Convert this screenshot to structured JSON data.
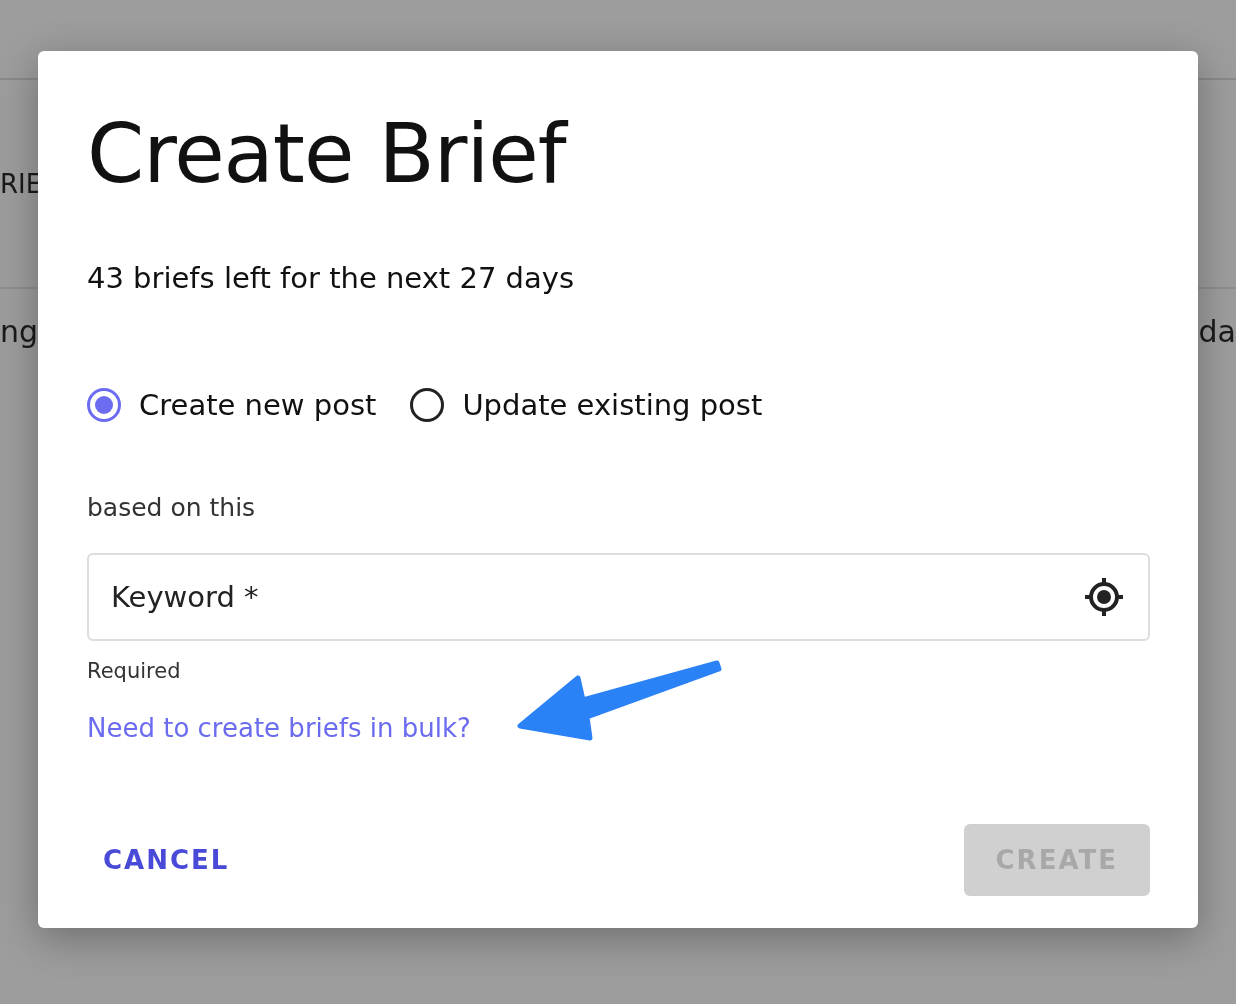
{
  "background": {
    "tab_fragment": "RIE",
    "row_start_fragment": "ng",
    "row_end_fragment": "da"
  },
  "dialog": {
    "title": "Create Brief",
    "subtitle": "43 briefs left for the next 27 days",
    "post_options": [
      {
        "label": "Create new post",
        "selected": true
      },
      {
        "label": "Update existing post",
        "selected": false
      }
    ],
    "based_on_label": "based on this",
    "keyword_field": {
      "placeholder": "Keyword *",
      "helper": "Required"
    },
    "bulk_link": "Need to create briefs in bulk?",
    "buttons": [
      {
        "label": "CANCEL",
        "kind": "text",
        "disabled": false
      },
      {
        "label": "CREATE",
        "kind": "contained",
        "disabled": true
      }
    ]
  }
}
